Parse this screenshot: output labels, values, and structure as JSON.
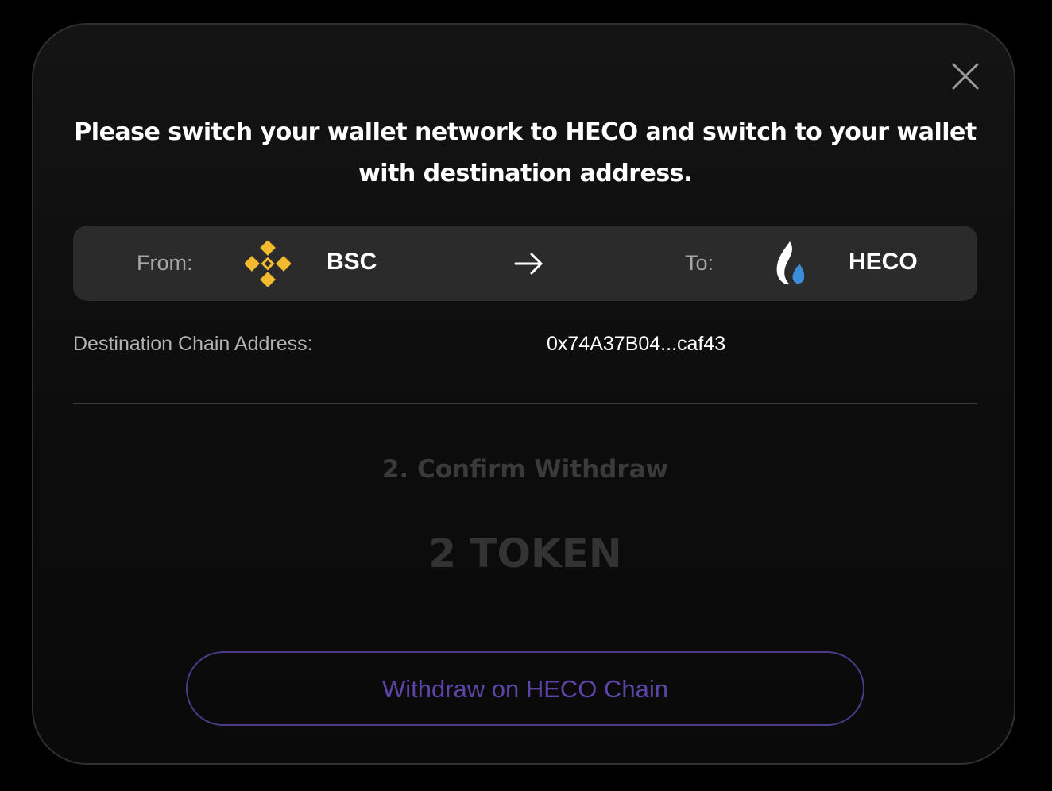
{
  "modal": {
    "heading": "Please switch your wallet network to HECO and switch to your wallet with destination address.",
    "route": {
      "from_label": "From:",
      "from_chain": "BSC",
      "from_icon": "bnb-icon",
      "arrow_icon": "arrow-right-icon",
      "to_label": "To:",
      "to_chain": "HECO",
      "to_icon": "heco-icon"
    },
    "destination": {
      "label": "Destination Chain Address:",
      "value": "0x74A37B04...caf43"
    },
    "step_title": "2. Confirm Withdraw",
    "amount": "2 TOKEN",
    "withdraw_button": "Withdraw on HECO Chain",
    "close_icon": "close-icon"
  },
  "colors": {
    "background": "#000000",
    "modal_bg": "#121212",
    "route_box_bg": "#2b2b2b",
    "bnb_gold": "#F3BA2F",
    "heco_blue": "#3b8cd9",
    "button_purple": "#5b46a8"
  }
}
